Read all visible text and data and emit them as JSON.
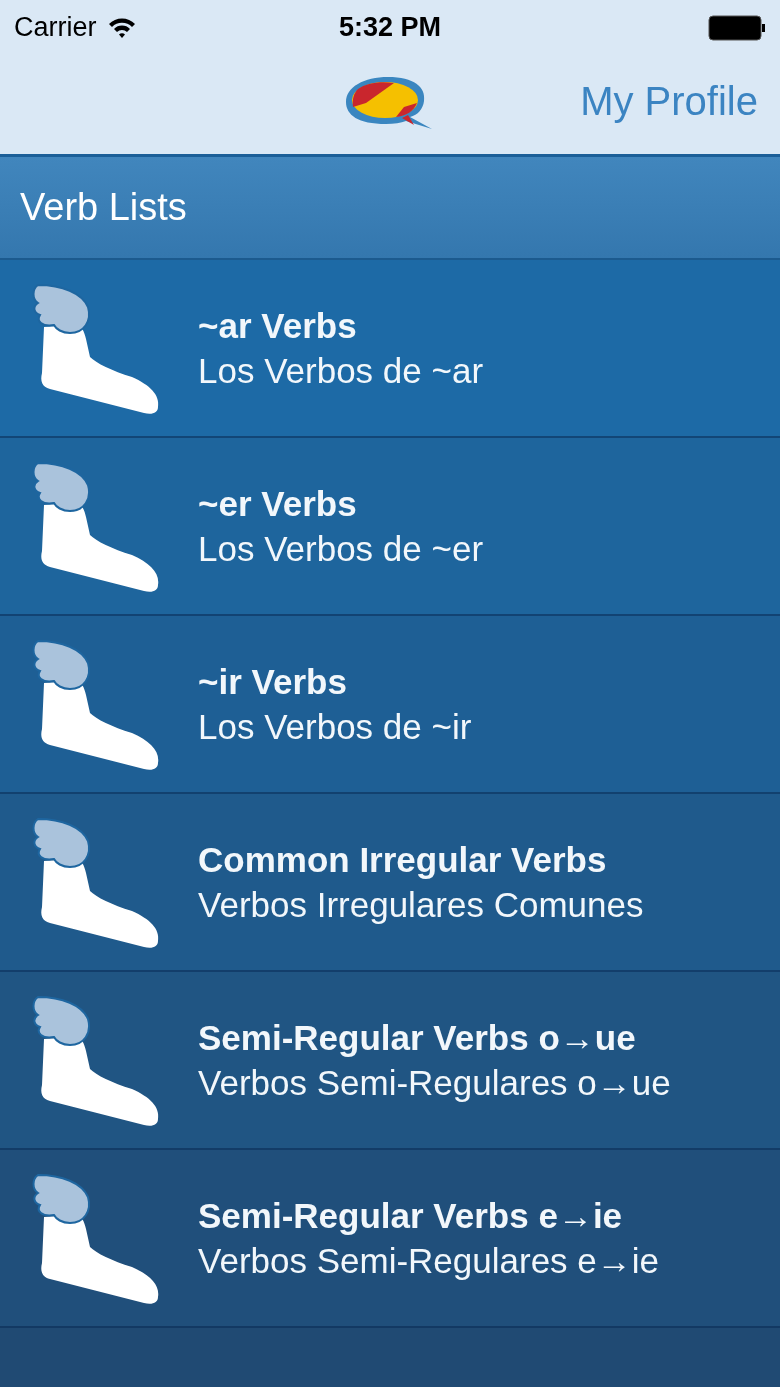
{
  "status_bar": {
    "carrier": "Carrier",
    "time": "5:32 PM"
  },
  "nav_bar": {
    "right_button": "My Profile"
  },
  "section_header": "Verb Lists",
  "verb_lists": [
    {
      "title": "~ar Verbs",
      "subtitle": "Los Verbos de ~ar"
    },
    {
      "title": "~er Verbs",
      "subtitle": "Los Verbos de ~er"
    },
    {
      "title": "~ir Verbs",
      "subtitle": "Los Verbos de ~ir"
    },
    {
      "title": "Common Irregular Verbs",
      "subtitle": "Verbos Irregulares Comunes"
    },
    {
      "title": "Semi-Regular Verbs o→ue",
      "subtitle": "Verbos Semi-Regulares o→ue"
    },
    {
      "title": "Semi-Regular Verbs e→ie",
      "subtitle": "Verbos Semi-Regulares e→ie"
    }
  ]
}
